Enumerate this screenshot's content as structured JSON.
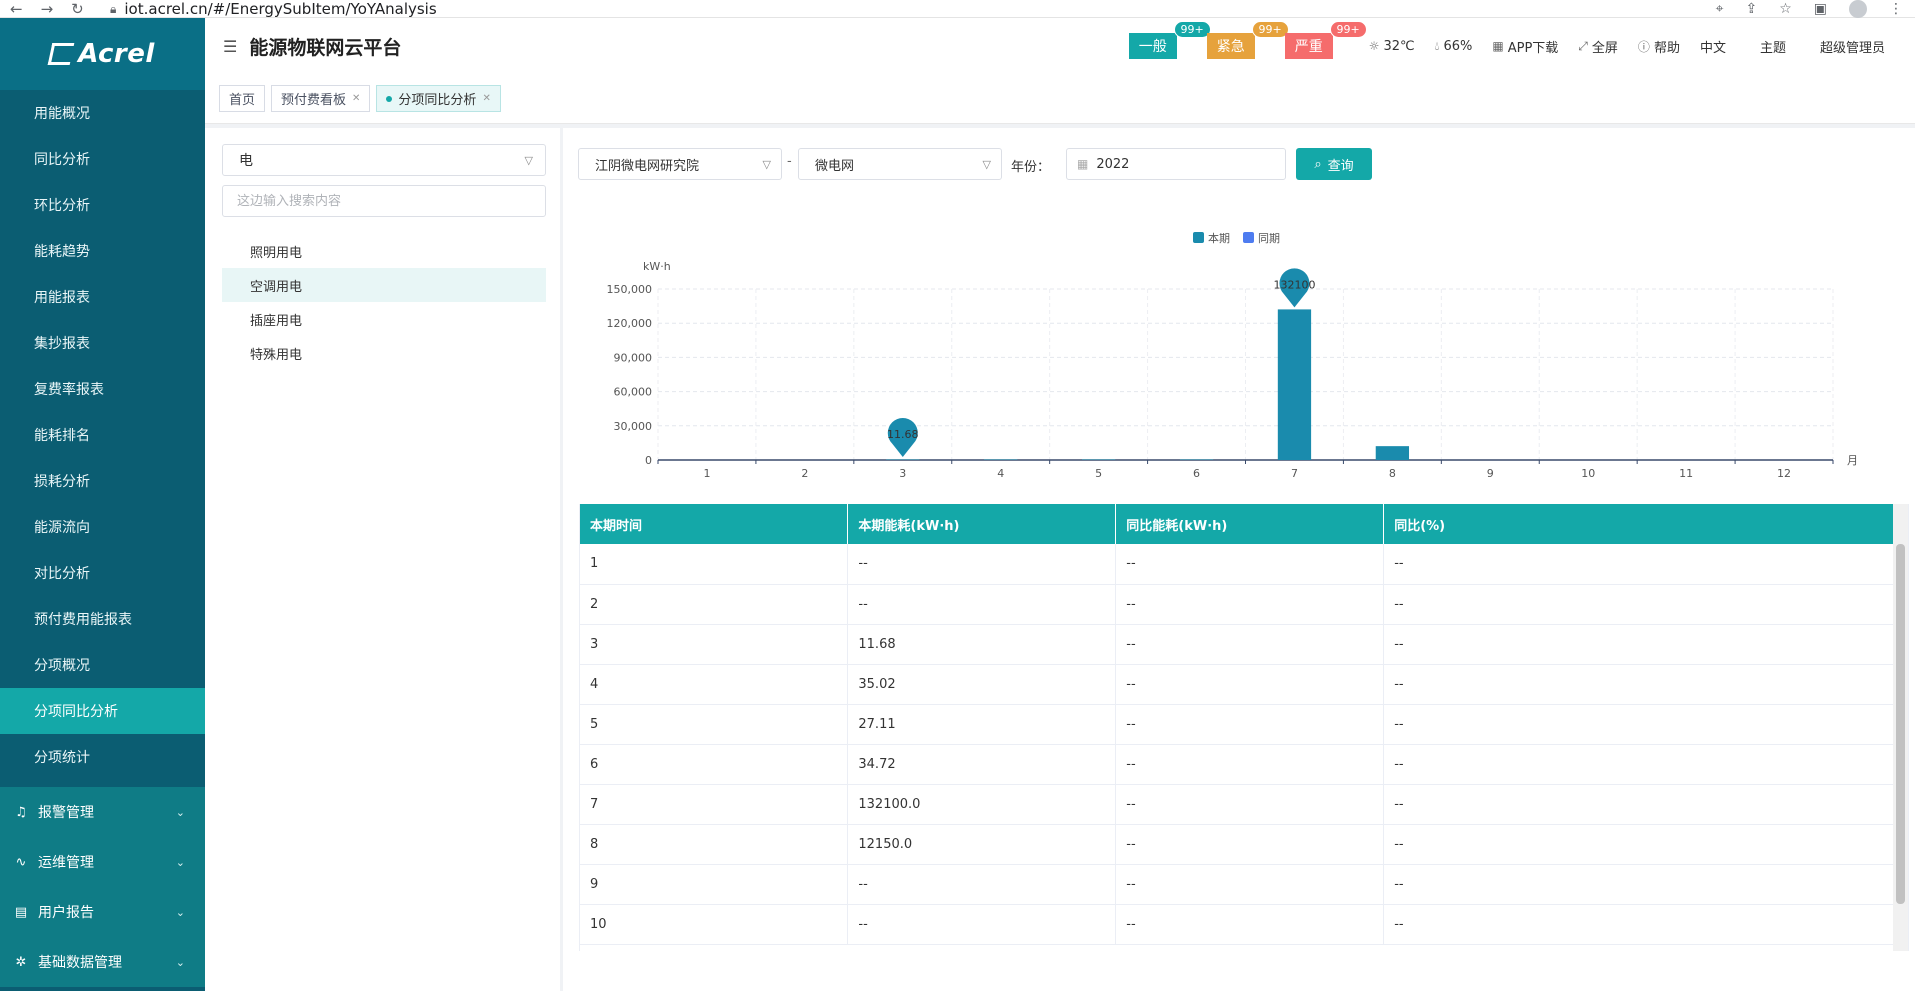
{
  "browser": {
    "url": "iot.acrel.cn/#/EnergySubItem/YoYAnalysis"
  },
  "logo": {
    "text": "Acrel"
  },
  "sidebar": {
    "items": [
      {
        "label": "用能概况",
        "active": false
      },
      {
        "label": "同比分析",
        "active": false
      },
      {
        "label": "环比分析",
        "active": false
      },
      {
        "label": "能耗趋势",
        "active": false
      },
      {
        "label": "用能报表",
        "active": false
      },
      {
        "label": "集抄报表",
        "active": false
      },
      {
        "label": "复费率报表",
        "active": false
      },
      {
        "label": "能耗排名",
        "active": false
      },
      {
        "label": "损耗分析",
        "active": false
      },
      {
        "label": "能源流向",
        "active": false
      },
      {
        "label": "对比分析",
        "active": false
      },
      {
        "label": "预付费用能报表",
        "active": false
      },
      {
        "label": "分项概况",
        "active": false
      },
      {
        "label": "分项同比分析",
        "active": true
      },
      {
        "label": "分项统计",
        "active": false
      }
    ],
    "groups": [
      {
        "label": "报警管理",
        "icon": "alarm-icon"
      },
      {
        "label": "运维管理",
        "icon": "maintenance-icon"
      },
      {
        "label": "用户报告",
        "icon": "report-icon"
      },
      {
        "label": "基础数据管理",
        "icon": "data-management-icon"
      }
    ]
  },
  "header": {
    "title": "能源物联网云平台",
    "alarms": [
      {
        "label": "一般",
        "count": "99+"
      },
      {
        "label": "紧急",
        "count": "99+"
      },
      {
        "label": "严重",
        "count": "99+"
      }
    ],
    "temperature": "32℃",
    "humidity": "66%",
    "app_download": "APP下载",
    "fullscreen": "全屏",
    "help": "帮助",
    "language": "中文",
    "theme": "主题",
    "user": "超级管理员"
  },
  "tabs": [
    {
      "label": "首页",
      "closable": false,
      "active": false
    },
    {
      "label": "预付费看板",
      "closable": true,
      "active": false
    },
    {
      "label": "分项同比分析",
      "closable": true,
      "active": true
    }
  ],
  "left_panel": {
    "energy_type": "电",
    "search_placeholder": "这边输入搜索内容",
    "tree": [
      {
        "label": "照明用电",
        "selected": false
      },
      {
        "label": "空调用电",
        "selected": true
      },
      {
        "label": "插座用电",
        "selected": false
      },
      {
        "label": "特殊用电",
        "selected": false
      }
    ]
  },
  "filters": {
    "site": "江阴微电网研究院",
    "separator": "-",
    "network": "微电网",
    "year_label": "年份：",
    "year": "2022",
    "query_button": "查询"
  },
  "chart_data": {
    "type": "bar",
    "legend": [
      "本期",
      "同期"
    ],
    "legend_position": "top-center",
    "ylabel": "kW·h",
    "xlabel": "月",
    "categories": [
      "1",
      "2",
      "3",
      "4",
      "5",
      "6",
      "7",
      "8",
      "9",
      "10",
      "11",
      "12"
    ],
    "ylim": [
      0,
      150000
    ],
    "yticks": [
      0,
      30000,
      60000,
      90000,
      120000,
      150000
    ],
    "ytick_labels": [
      "0",
      "30,000",
      "60,000",
      "90,000",
      "120,000",
      "150,000"
    ],
    "series": [
      {
        "name": "本期",
        "values": [
          0,
          0,
          11.68,
          35.02,
          27.11,
          34.72,
          132100,
          12150,
          0,
          0,
          0,
          0
        ],
        "color": "#1a8bad"
      },
      {
        "name": "同期",
        "values": [
          0,
          0,
          0,
          0,
          0,
          0,
          0,
          0,
          0,
          0,
          0,
          0
        ],
        "color": "#4e7cf0"
      }
    ],
    "markers": [
      {
        "category": "3",
        "label": "11.68"
      },
      {
        "category": "7",
        "label": "132100"
      }
    ],
    "grid": true
  },
  "table": {
    "columns": [
      "本期时间",
      "本期能耗(kW·h)",
      "同比能耗(kW·h)",
      "同比(%)"
    ],
    "rows": [
      [
        "1",
        "--",
        "--",
        "--"
      ],
      [
        "2",
        "--",
        "--",
        "--"
      ],
      [
        "3",
        "11.68",
        "--",
        "--"
      ],
      [
        "4",
        "35.02",
        "--",
        "--"
      ],
      [
        "5",
        "27.11",
        "--",
        "--"
      ],
      [
        "6",
        "34.72",
        "--",
        "--"
      ],
      [
        "7",
        "132100.0",
        "--",
        "--"
      ],
      [
        "8",
        "12150.0",
        "--",
        "--"
      ],
      [
        "9",
        "--",
        "--",
        "--"
      ],
      [
        "10",
        "--",
        "--",
        "--"
      ]
    ]
  },
  "colors": {
    "sidebar_bg": "#0b5d72",
    "accent": "#14a8a8",
    "bar": "#1a8bad",
    "compare": "#4e7cf0",
    "alarm_normal": "#14a8a8",
    "alarm_urgent": "#e6a23c",
    "alarm_serious": "#f56c6c"
  }
}
